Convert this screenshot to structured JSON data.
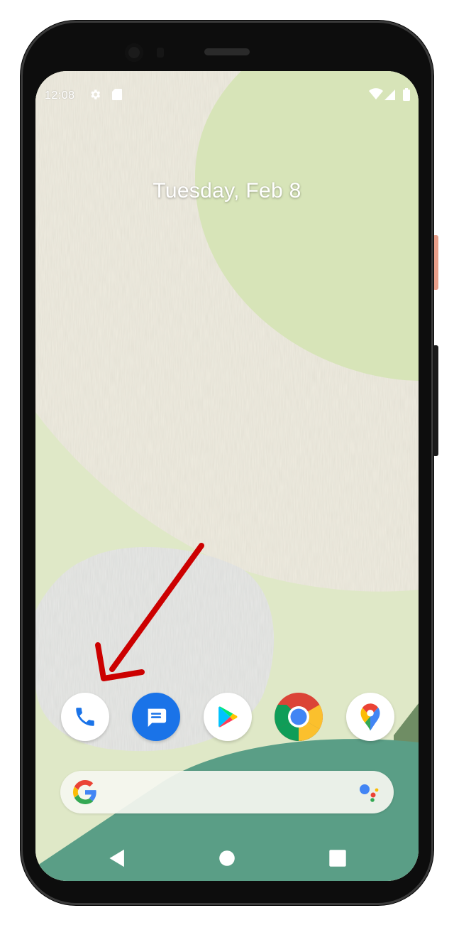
{
  "status_bar": {
    "time": "12:08",
    "left_icons": [
      "gear-icon",
      "sd-card-icon"
    ],
    "right_icons": [
      "wifi-icon",
      "signal-icon",
      "battery-icon"
    ]
  },
  "home": {
    "date": "Tuesday, Feb 8"
  },
  "dock": {
    "apps": [
      "Phone",
      "Messages",
      "Play Store",
      "Chrome",
      "Maps"
    ]
  },
  "search_bar": {
    "logo": "google-g-icon",
    "right_icon": "google-assistant-icon"
  },
  "navigation": [
    "back-icon",
    "home-icon",
    "recents-icon"
  ],
  "annotation": {
    "type": "arrow",
    "color": "#cc0000",
    "points_to": "Phone"
  },
  "colors": {
    "wallpaper_green": "#dfe8c7",
    "wallpaper_cream": "#efece0",
    "wallpaper_teal": "#5a9e86",
    "accent_blue": "#1a73e8"
  }
}
